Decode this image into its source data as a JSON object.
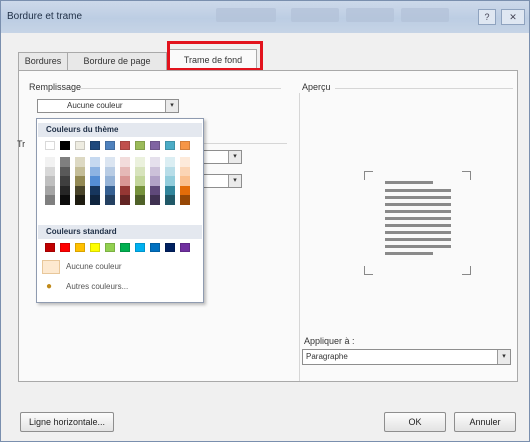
{
  "window": {
    "title": "Bordure et trame",
    "help_icon": "?",
    "close_icon": "✕"
  },
  "tabs": [
    {
      "label": "Bordures"
    },
    {
      "label": "Bordure de page"
    },
    {
      "label": "Trame de fond"
    }
  ],
  "fill": {
    "group_label": "Remplissage",
    "value": "Aucune couleur",
    "arrow": "▾"
  },
  "style_group": {
    "label": "Tr"
  },
  "dropdown": {
    "theme_heading": "Couleurs du thème",
    "standard_heading": "Couleurs standard",
    "no_color": "Aucune couleur",
    "more_colors": "Autres couleurs...",
    "theme_colors": [
      "#ffffff",
      "#000000",
      "#eeece1",
      "#1f497d",
      "#4f81bd",
      "#c0504d",
      "#9bbb59",
      "#8064a2",
      "#4bacc6",
      "#f79646"
    ],
    "theme_shades": [
      [
        "#f2f2f2",
        "#d8d8d8",
        "#bfbfbf",
        "#a5a5a5",
        "#7f7f7f"
      ],
      [
        "#7f7f7f",
        "#595959",
        "#3f3f3f",
        "#262626",
        "#0c0c0c"
      ],
      [
        "#ddd9c3",
        "#c4bd97",
        "#938953",
        "#494429",
        "#1d1b10"
      ],
      [
        "#c6d9f0",
        "#8db3e2",
        "#548dd4",
        "#17365d",
        "#0f243e"
      ],
      [
        "#dbe5f1",
        "#b8cce4",
        "#95b3d7",
        "#366092",
        "#244061"
      ],
      [
        "#f2dcdb",
        "#e5b9b7",
        "#d99694",
        "#953734",
        "#632423"
      ],
      [
        "#ebf1dd",
        "#d7e3bc",
        "#c3d69b",
        "#76923c",
        "#4f6128"
      ],
      [
        "#e5e0ec",
        "#ccc1d9",
        "#b2a2c7",
        "#5f497a",
        "#3f3151"
      ],
      [
        "#dbeef3",
        "#b7dde8",
        "#92cddc",
        "#31859b",
        "#205867"
      ],
      [
        "#fdeada",
        "#fbd5b5",
        "#fac08f",
        "#e36c09",
        "#974806"
      ]
    ],
    "standard_colors": [
      "#c00000",
      "#ff0000",
      "#ffc000",
      "#ffff00",
      "#92d050",
      "#00b050",
      "#00b0f0",
      "#0070c0",
      "#002060",
      "#7030a0"
    ]
  },
  "preview": {
    "label": "Aperçu"
  },
  "apply": {
    "label": "Appliquer à :",
    "value": "Paragraphe",
    "arrow": "▾"
  },
  "buttons": {
    "horizontal_line": "Ligne horizontale...",
    "ok": "OK",
    "cancel": "Annuler"
  }
}
